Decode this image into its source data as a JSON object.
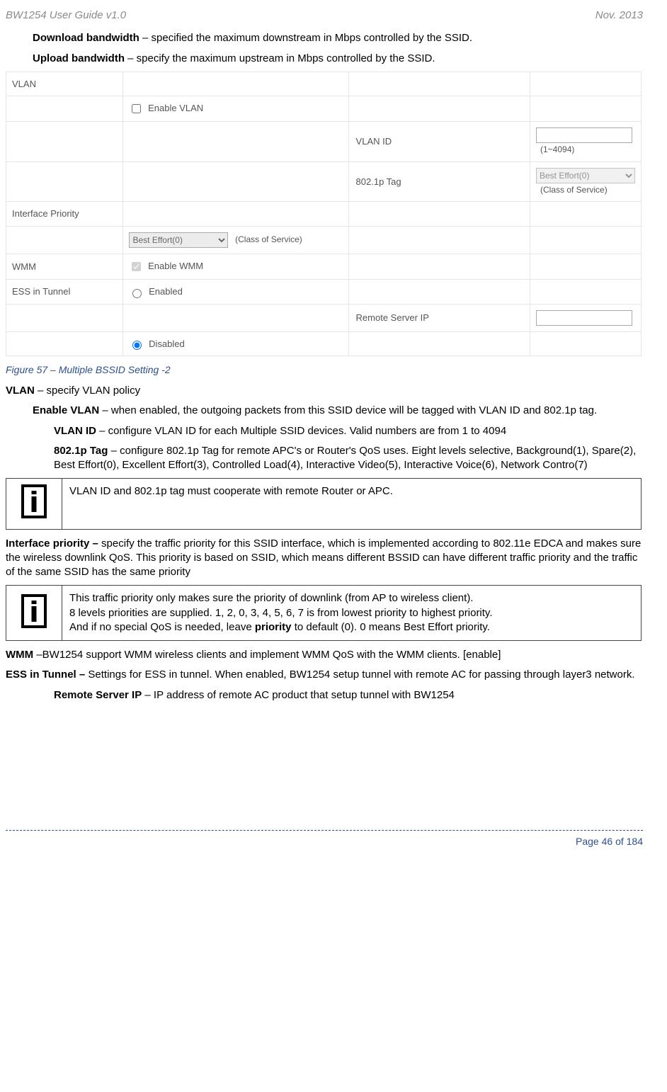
{
  "header": {
    "left": "BW1254 User Guide v1.0",
    "right": "Nov.  2013"
  },
  "intro": {
    "dl_b": "Download bandwidth",
    "dl_t": " – specified the maximum downstream in Mbps controlled by the SSID.",
    "ul_b": "Upload bandwidth",
    "ul_t": " – specify the maximum upstream in Mbps controlled by the SSID."
  },
  "settings": {
    "vlan_lbl": "VLAN",
    "enable_vlan": "Enable VLAN",
    "vlan_id_lbl": "VLAN ID",
    "vlan_id_hint": "(1~4094)",
    "tag_lbl": "802.1p Tag",
    "tag_sel": "Best Effort(0)",
    "cos": "(Class of Service)",
    "if_prio_lbl": "Interface Priority",
    "if_prio_sel": "Best Effort(0)",
    "wmm_lbl": "WMM",
    "enable_wmm": "Enable WMM",
    "ess_lbl": "ESS in Tunnel",
    "ess_en": "Enabled",
    "ess_dis": "Disabled",
    "remote_ip_lbl": "Remote Server IP"
  },
  "figcap": "Figure 57 –  Multiple BSSID Setting -2",
  "vlan": {
    "head_b": "VLAN ",
    "head_t": " – specify VLAN policy",
    "en_b": "Enable VLAN",
    "en_t": " – when enabled, the outgoing packets from this SSID device will be tagged with VLAN ID and 802.1p tag.",
    "id_b": "VLAN ID",
    "id_t": " – configure VLAN ID for each Multiple SSID devices. Valid numbers are from 1 to 4094",
    "tag_b": "802.1p Tag",
    "tag_t": " – configure 802.1p Tag for remote APC's or Router's QoS uses. Eight levels selective, Background(1), Spare(2), Best Effort(0), Excellent Effort(3), Controlled Load(4), Interactive Video(5), Interactive Voice(6), Network Contro(7)"
  },
  "info1": "VLAN ID and 802.1p tag must cooperate with remote Router or APC.",
  "ifprio": {
    "b": "Interface priority – ",
    "t": "specify the traffic priority for this SSID interface, which is implemented according to 802.11e EDCA and makes sure the wireless downlink QoS. This priority is based on SSID, which means different BSSID can have different traffic priority and the traffic of the same SSID has the same priority"
  },
  "info2": {
    "l1": "This traffic priority only makes sure the priority of downlink (from AP to wireless client).",
    "l2": "8 levels priorities are supplied. 1, 2, 0, 3, 4, 5, 6, 7 is from lowest priority to highest priority.",
    "l3a": "And if no special QoS is needed, leave ",
    "l3b": "priority",
    "l3c": " to default (0). 0 means Best Effort priority."
  },
  "wmm": {
    "b": "WMM ",
    "t": "–BW1254 support WMM wireless clients and implement WMM QoS with the WMM clients. [enable]"
  },
  "ess": {
    "b": "ESS in Tunnel – ",
    "t": "Settings for ESS in tunnel. When enabled, BW1254 setup tunnel with remote AC for passing through layer3 network.",
    "rip_b": "Remote Server IP",
    "rip_t": " – IP address of remote AC product that setup tunnel with BW1254"
  },
  "footer": "Page 46 of 184"
}
